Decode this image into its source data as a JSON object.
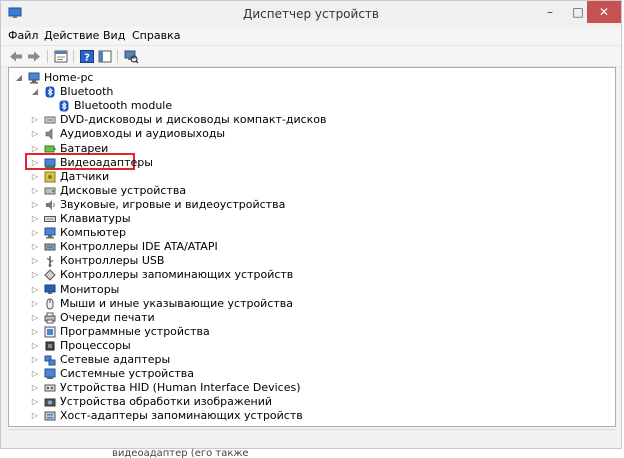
{
  "window": {
    "title": "Диспетчер устройств",
    "controls": {
      "minimize": "–",
      "maximize": "□",
      "close": "✕"
    }
  },
  "menu": [
    "Файл",
    "Действие",
    "Вид",
    "Справка"
  ],
  "toolbar_icons": [
    "back-icon",
    "forward-icon",
    "properties-icon",
    "help-icon",
    "scan-hardware-icon"
  ],
  "tree": {
    "root": "Home-pc",
    "items": [
      {
        "label": "Bluetooth",
        "icon": "bluetooth-icon",
        "expanded": true
      },
      {
        "label": "Bluetooth module",
        "icon": "bluetooth-icon",
        "child": true
      },
      {
        "label": "DVD-дисководы и дисководы компакт-дисков",
        "icon": "dvd-icon"
      },
      {
        "label": "Аудиовходы и аудиовыходы",
        "icon": "audio-icon"
      },
      {
        "label": "Батареи",
        "icon": "battery-icon"
      },
      {
        "label": "Видеоадаптеры",
        "icon": "display-adapter-icon",
        "highlighted": true
      },
      {
        "label": "Датчики",
        "icon": "sensor-icon"
      },
      {
        "label": "Дисковые устройства",
        "icon": "disk-icon"
      },
      {
        "label": "Звуковые, игровые и видеоустройства",
        "icon": "sound-icon"
      },
      {
        "label": "Клавиатуры",
        "icon": "keyboard-icon"
      },
      {
        "label": "Компьютер",
        "icon": "computer-icon"
      },
      {
        "label": "Контроллеры IDE ATA/ATAPI",
        "icon": "ide-controller-icon"
      },
      {
        "label": "Контроллеры USB",
        "icon": "usb-icon"
      },
      {
        "label": "Контроллеры запоминающих устройств",
        "icon": "storage-controller-icon"
      },
      {
        "label": "Мониторы",
        "icon": "monitor-icon"
      },
      {
        "label": "Мыши и иные указывающие устройства",
        "icon": "mouse-icon"
      },
      {
        "label": "Очереди печати",
        "icon": "printer-icon"
      },
      {
        "label": "Программные устройства",
        "icon": "software-device-icon"
      },
      {
        "label": "Процессоры",
        "icon": "processor-icon"
      },
      {
        "label": "Сетевые адаптеры",
        "icon": "network-icon"
      },
      {
        "label": "Системные устройства",
        "icon": "system-device-icon"
      },
      {
        "label": "Устройства HID (Human Interface Devices)",
        "icon": "hid-icon"
      },
      {
        "label": "Устройства обработки изображений",
        "icon": "imaging-icon"
      },
      {
        "label": "Хост-адаптеры запоминающих устройств",
        "icon": "storage-host-icon"
      }
    ]
  },
  "below_text": "видеоадаптер (его также",
  "colors": {
    "highlight": "#e0262b",
    "close_button": "#c75050"
  }
}
